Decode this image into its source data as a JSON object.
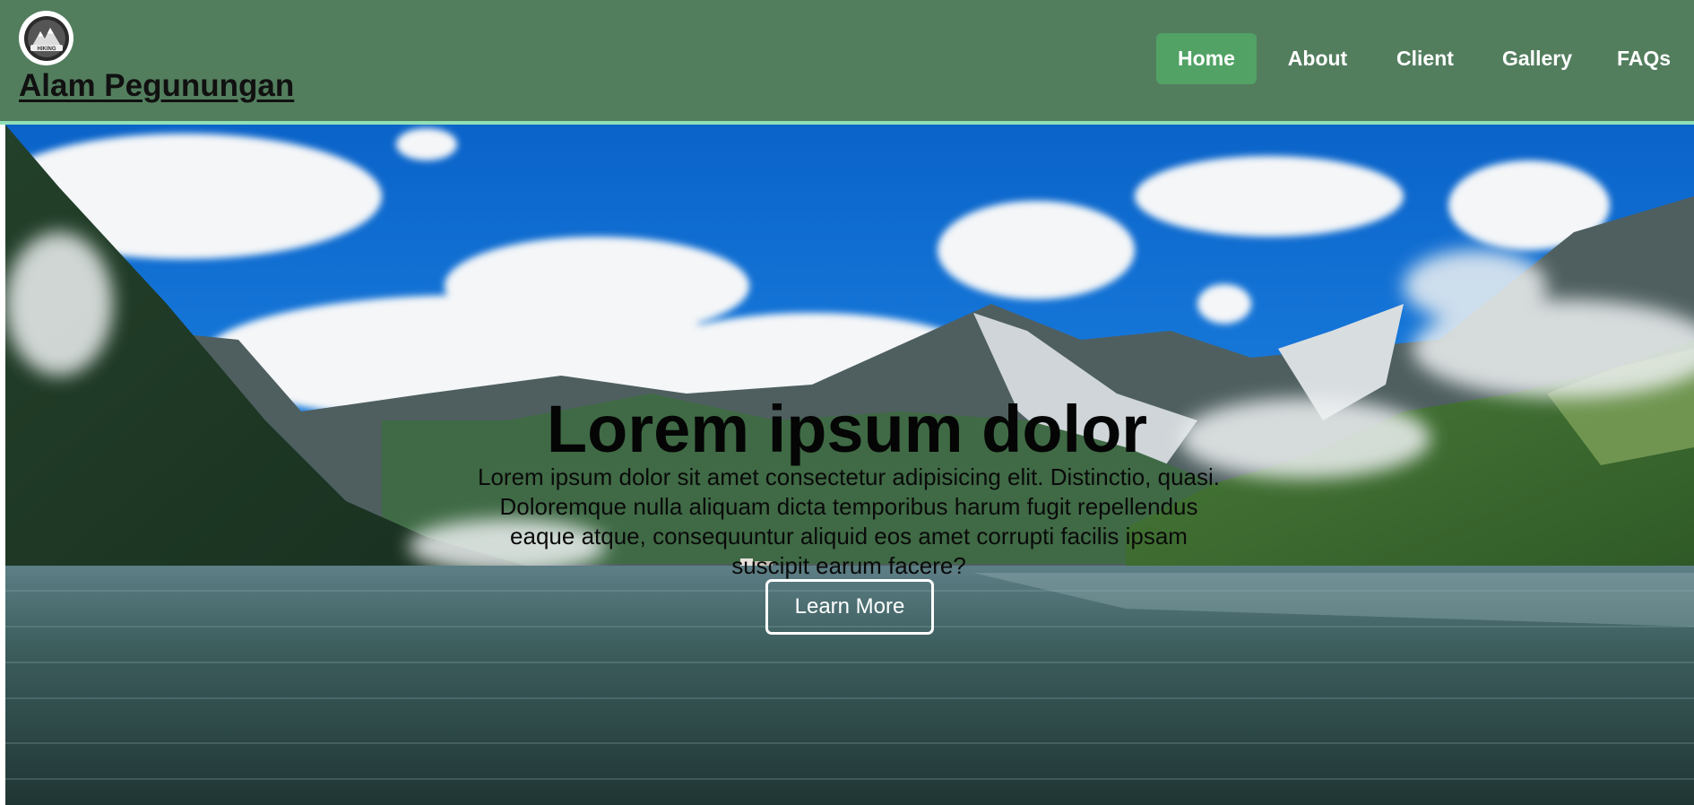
{
  "brand": {
    "logo_icon": "mountain-badge-icon",
    "logo_text": "HIKING",
    "name": "Alam Pegunungan"
  },
  "nav": {
    "items": [
      {
        "label": "Home",
        "active": true
      },
      {
        "label": "About",
        "active": false
      },
      {
        "label": "Client",
        "active": false
      },
      {
        "label": "Gallery",
        "active": false
      },
      {
        "label": "FAQs",
        "active": false
      }
    ]
  },
  "hero": {
    "background_description_icon": "mountain-lake-landscape",
    "title": "Lorem ipsum dolor",
    "text": "Lorem ipsum dolor sit amet consectetur adipisicing elit. Distinctio, quasi. Doloremque nulla aliquam dicta temporibus harum fugit repellendus eaque atque, consequuntur aliquid eos amet corrupti facilis ipsam suscipit earum facere?",
    "button_label": "Learn More"
  },
  "colors": {
    "navbar": "#537e5e",
    "nav_active": "#52a265",
    "accent_line": "#8fe0b8"
  }
}
